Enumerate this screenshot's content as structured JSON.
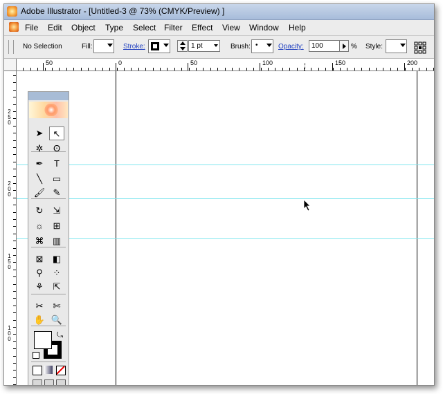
{
  "window": {
    "title": "Adobe Illustrator - [Untitled-3 @ 73% (CMYK/Preview) ]"
  },
  "menu": {
    "items": [
      {
        "label": "File"
      },
      {
        "label": "Edit"
      },
      {
        "label": "Object"
      },
      {
        "label": "Type"
      },
      {
        "label": "Select"
      },
      {
        "label": "Filter"
      },
      {
        "label": "Effect"
      },
      {
        "label": "View"
      },
      {
        "label": "Window"
      },
      {
        "label": "Help"
      }
    ]
  },
  "control_bar": {
    "selection_status": "No Selection",
    "fill_label": "Fill:",
    "stroke_label": "Stroke:",
    "stroke_weight": "1 pt",
    "brush_label": "Brush:",
    "brush_value": "•",
    "opacity_label": "Opacity:",
    "opacity_value": "100",
    "opacity_unit": "%",
    "style_label": "Style:"
  },
  "ruler_top": {
    "labels": [
      "50",
      "0",
      "50",
      "100",
      "150",
      "200"
    ]
  },
  "ruler_left": {
    "labels": [
      "250",
      "200",
      "150",
      "100"
    ]
  },
  "toolbox": {
    "tools": [
      {
        "name": "selection-tool",
        "glyph": "➤"
      },
      {
        "name": "direct-selection-tool",
        "glyph": "↖"
      },
      {
        "name": "magic-wand-tool",
        "glyph": "✲"
      },
      {
        "name": "lasso-tool",
        "glyph": "ʘ"
      },
      {
        "name": "pen-tool",
        "glyph": "✒"
      },
      {
        "name": "type-tool",
        "glyph": "T"
      },
      {
        "name": "line-segment-tool",
        "glyph": "╲"
      },
      {
        "name": "rectangle-tool",
        "glyph": "▭"
      },
      {
        "name": "paintbrush-tool",
        "glyph": "🖌"
      },
      {
        "name": "pencil-tool",
        "glyph": "✎"
      },
      {
        "name": "rotate-tool",
        "glyph": "↻"
      },
      {
        "name": "scale-tool",
        "glyph": "⇲"
      },
      {
        "name": "warp-tool",
        "glyph": "☼"
      },
      {
        "name": "free-transform-tool",
        "glyph": "⊞"
      },
      {
        "name": "symbol-sprayer-tool",
        "glyph": "⌘"
      },
      {
        "name": "column-graph-tool",
        "glyph": "▥"
      },
      {
        "name": "mesh-tool",
        "glyph": "⊠"
      },
      {
        "name": "gradient-tool",
        "glyph": "◧"
      },
      {
        "name": "eyedropper-tool",
        "glyph": "⚲"
      },
      {
        "name": "blend-tool",
        "glyph": "⁘"
      },
      {
        "name": "live-paint-bucket-tool",
        "glyph": "⚘"
      },
      {
        "name": "live-paint-selection-tool",
        "glyph": "⇱"
      },
      {
        "name": "slice-tool",
        "glyph": "✂"
      },
      {
        "name": "scissors-tool",
        "glyph": "✄"
      },
      {
        "name": "hand-tool",
        "glyph": "✋"
      },
      {
        "name": "zoom-tool",
        "glyph": "🔍"
      }
    ],
    "selected_tool": "direct-selection-tool"
  },
  "colors": {
    "guide": "#7fe6ee",
    "titlebar": "#b7c9e2",
    "link": "#1f3fbf"
  }
}
